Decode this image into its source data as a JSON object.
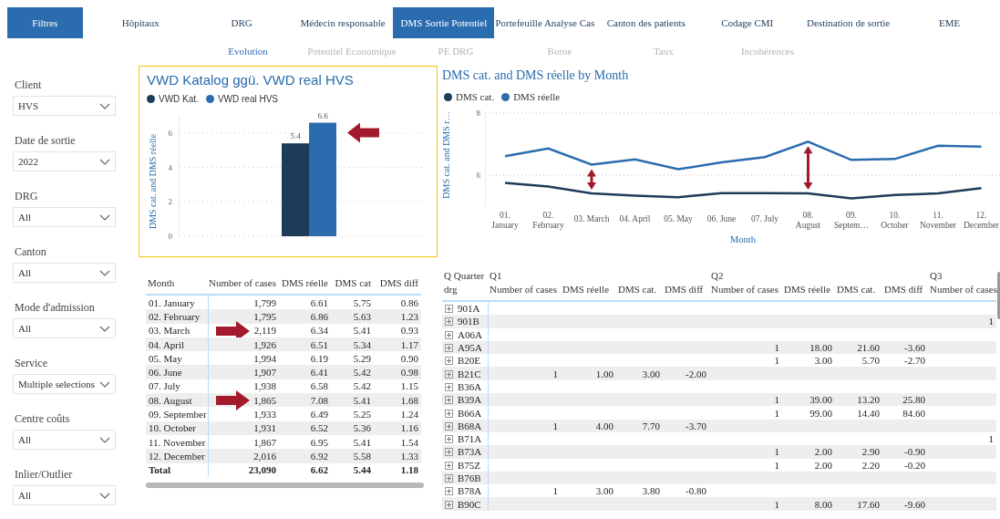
{
  "nav": [
    {
      "label": "Filtres",
      "selected": true
    },
    {
      "label": "Hôpitaux",
      "selected": false
    },
    {
      "label": "DRG",
      "selected": false
    },
    {
      "label": "Médecin responsable",
      "selected": false
    },
    {
      "label": "DMS Sortie Potentiel",
      "selected": true
    },
    {
      "label": "Portefeuille Analyse Cas",
      "selected": false
    },
    {
      "label": "Canton des patients",
      "selected": false
    },
    {
      "label": "Codage CMI",
      "selected": false
    },
    {
      "label": "Destination de sortie",
      "selected": false
    },
    {
      "label": "EME",
      "selected": false
    }
  ],
  "subnav": [
    {
      "label": "Evolution",
      "selected": true
    },
    {
      "label": "Potentiel Economique",
      "selected": false
    },
    {
      "label": "PE DRG",
      "selected": false
    },
    {
      "label": "Borne",
      "selected": false
    },
    {
      "label": "Taux",
      "selected": false
    },
    {
      "label": "Incohérences",
      "selected": false
    }
  ],
  "filters": [
    {
      "label": "Client",
      "value": "HVS"
    },
    {
      "label": "Date de sortie",
      "value": "2022"
    },
    {
      "label": "DRG",
      "value": "All"
    },
    {
      "label": "Canton",
      "value": "All"
    },
    {
      "label": "Mode d'admission",
      "value": "All"
    },
    {
      "label": "Service",
      "value": "Multiple selections"
    },
    {
      "label": "Centre coûts",
      "value": "All"
    },
    {
      "label": "Inlier/Outlier",
      "value": "All"
    }
  ],
  "bar_chart": {
    "chart_data": {
      "type": "bar",
      "title": "VWD Katalog ggü. VWD real HVS",
      "ylabel": "DMS cat. and DMS réelle",
      "series": [
        {
          "name": "VWD Kat.",
          "color": "#1f3b5a",
          "values": [
            5.4
          ]
        },
        {
          "name": "VWD real HVS",
          "color": "#2a6cae",
          "values": [
            6.6
          ]
        }
      ],
      "ylim": [
        0,
        7
      ],
      "yticks": [
        0,
        2,
        4,
        6
      ],
      "grid": true,
      "data_labels": true
    },
    "arrow": true
  },
  "line_chart": {
    "chart_data": {
      "type": "line",
      "title": "DMS cat. and DMS réelle by Month",
      "xlabel": "Month",
      "ylabel": "DMS cat. and DMS r…",
      "categories": [
        "01. January",
        "02. February",
        "03. March",
        "04. April",
        "05. May",
        "06. June",
        "07. July",
        "08. August",
        "09. Septem…",
        "10. October",
        "11. November",
        "12. December"
      ],
      "series": [
        {
          "name": "DMS cat.",
          "color": "#1f3b5a",
          "values": [
            5.75,
            5.63,
            5.41,
            5.34,
            5.29,
            5.42,
            5.42,
            5.41,
            5.25,
            5.36,
            5.41,
            5.58
          ]
        },
        {
          "name": "DMS réelle",
          "color": "#2a6cae",
          "values": [
            6.61,
            6.86,
            6.34,
            6.51,
            6.19,
            6.41,
            6.58,
            7.08,
            6.49,
            6.52,
            6.95,
            6.92
          ]
        }
      ],
      "ylim": [
        5,
        8
      ],
      "yticks": [
        6,
        8
      ],
      "grid": true
    },
    "gap_arrows": [
      false,
      false,
      true,
      false,
      false,
      false,
      false,
      true,
      false,
      false,
      false,
      false
    ]
  },
  "month_table": {
    "columns": [
      "Month",
      "Number of cases",
      "DMS réelle",
      "DMS cat",
      "DMS diff"
    ],
    "rows": [
      {
        "month": "01. January",
        "cases": "1,799",
        "reelle": "6.61",
        "cat": "5.75",
        "diff": "0.86",
        "arrow": false
      },
      {
        "month": "02. February",
        "cases": "1,795",
        "reelle": "6.86",
        "cat": "5.63",
        "diff": "1.23",
        "arrow": false
      },
      {
        "month": "03. March",
        "cases": "2,119",
        "reelle": "6.34",
        "cat": "5.41",
        "diff": "0.93",
        "arrow": true
      },
      {
        "month": "04. April",
        "cases": "1,926",
        "reelle": "6.51",
        "cat": "5.34",
        "diff": "1.17",
        "arrow": false
      },
      {
        "month": "05. May",
        "cases": "1,994",
        "reelle": "6.19",
        "cat": "5.29",
        "diff": "0.90",
        "arrow": false
      },
      {
        "month": "06. June",
        "cases": "1,907",
        "reelle": "6.41",
        "cat": "5.42",
        "diff": "0.98",
        "arrow": false
      },
      {
        "month": "07. July",
        "cases": "1,938",
        "reelle": "6.58",
        "cat": "5.42",
        "diff": "1.15",
        "arrow": false
      },
      {
        "month": "08. August",
        "cases": "1,865",
        "reelle": "7.08",
        "cat": "5.41",
        "diff": "1.68",
        "arrow": true
      },
      {
        "month": "09. September",
        "cases": "1,933",
        "reelle": "6.49",
        "cat": "5.25",
        "diff": "1.24",
        "arrow": false
      },
      {
        "month": "10. October",
        "cases": "1,931",
        "reelle": "6.52",
        "cat": "5.36",
        "diff": "1.16",
        "arrow": false
      },
      {
        "month": "11. November",
        "cases": "1,867",
        "reelle": "6.95",
        "cat": "5.41",
        "diff": "1.54",
        "arrow": false
      },
      {
        "month": "12. December",
        "cases": "2,016",
        "reelle": "6.92",
        "cat": "5.58",
        "diff": "1.33",
        "arrow": false
      }
    ],
    "total": {
      "month": "Total",
      "cases": "23,090",
      "reelle": "6.62",
      "cat": "5.44",
      "diff": "1.18"
    }
  },
  "matrix": {
    "corner": [
      "Q Quarter",
      "drg"
    ],
    "groups": [
      {
        "label": "Q1",
        "columns": [
          "Number of cases",
          "DMS réelle",
          "DMS cat.",
          "DMS diff"
        ]
      },
      {
        "label": "Q2",
        "columns": [
          "Number of cases",
          "DMS réelle",
          "DMS cat.",
          "DMS diff"
        ]
      },
      {
        "label": "Q3",
        "columns": [
          "Number of cases"
        ]
      }
    ],
    "rows": [
      {
        "drg": "901A",
        "cells": [
          null,
          null,
          null,
          null,
          null,
          null,
          null,
          null,
          null
        ]
      },
      {
        "drg": "901B",
        "cells": [
          null,
          null,
          null,
          null,
          null,
          null,
          null,
          null,
          "1"
        ]
      },
      {
        "drg": "A06A",
        "cells": [
          null,
          null,
          null,
          null,
          null,
          null,
          null,
          null,
          null
        ]
      },
      {
        "drg": "A95A",
        "cells": [
          null,
          null,
          null,
          null,
          "1",
          "18.00",
          "21.60",
          "-3.60",
          null
        ]
      },
      {
        "drg": "B20E",
        "cells": [
          null,
          null,
          null,
          null,
          "1",
          "3.00",
          "5.70",
          "-2.70",
          null
        ]
      },
      {
        "drg": "B21C",
        "cells": [
          "1",
          "1.00",
          "3.00",
          "-2.00",
          null,
          null,
          null,
          null,
          null
        ]
      },
      {
        "drg": "B36A",
        "cells": [
          null,
          null,
          null,
          null,
          null,
          null,
          null,
          null,
          null
        ]
      },
      {
        "drg": "B39A",
        "cells": [
          null,
          null,
          null,
          null,
          "1",
          "39.00",
          "13.20",
          "25.80",
          null
        ]
      },
      {
        "drg": "B66A",
        "cells": [
          null,
          null,
          null,
          null,
          "1",
          "99.00",
          "14.40",
          "84.60",
          null
        ]
      },
      {
        "drg": "B68A",
        "cells": [
          "1",
          "4.00",
          "7.70",
          "-3.70",
          null,
          null,
          null,
          null,
          null
        ]
      },
      {
        "drg": "B71A",
        "cells": [
          null,
          null,
          null,
          null,
          null,
          null,
          null,
          null,
          "1"
        ]
      },
      {
        "drg": "B73A",
        "cells": [
          null,
          null,
          null,
          null,
          "1",
          "2.00",
          "2.90",
          "-0.90",
          null
        ]
      },
      {
        "drg": "B75Z",
        "cells": [
          null,
          null,
          null,
          null,
          "1",
          "2.00",
          "2.20",
          "-0.20",
          null
        ]
      },
      {
        "drg": "B76B",
        "cells": [
          null,
          null,
          null,
          null,
          null,
          null,
          null,
          null,
          null
        ]
      },
      {
        "drg": "B78A",
        "cells": [
          "1",
          "3.00",
          "3.80",
          "-0.80",
          null,
          null,
          null,
          null,
          null
        ]
      },
      {
        "drg": "B90C",
        "cells": [
          null,
          null,
          null,
          null,
          "1",
          "8.00",
          "17.60",
          "-9.60",
          null
        ]
      }
    ]
  }
}
